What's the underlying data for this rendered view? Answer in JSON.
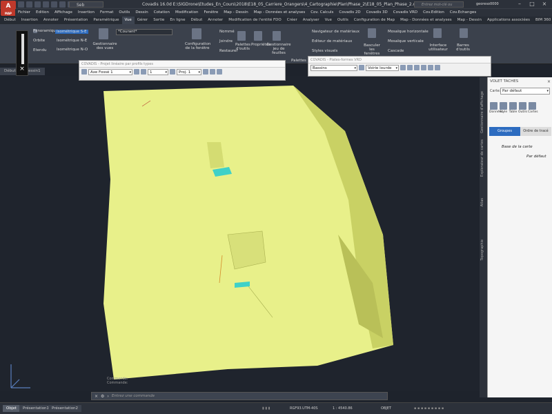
{
  "app": {
    "logo": "A",
    "logo_sub": "MAP",
    "workspace": "Seb",
    "title": "Covadis 16.0d    E:\\SIGDrone\\Etudes_En_Cours\\2018\\E18_05_Carriere_Orangers\\4_Cartographie\\Plan\\Phase_2\\E18_05_Plan_Phase_2.dwg (1:200)",
    "search_placeholder": "Entrez mot-clé ou expression",
    "user": "georeso0000"
  },
  "menu": [
    "Fichier",
    "Edition",
    "Affichage",
    "Insertion",
    "Format",
    "Outils",
    "Dessin",
    "Cotation",
    "Modification",
    "Fenêtre",
    "Map - Dessin",
    "Map - Données et analyses",
    "Cov. Calculs",
    "Covadis 2D",
    "Covadis 3D",
    "Covadis VRD",
    "Cov.Edition",
    "Cov.Echanges"
  ],
  "ribbon_tabs": [
    "Début",
    "Insertion",
    "Annoter",
    "Présentation",
    "Paramétrique",
    "Vue",
    "Gérer",
    "Sortie",
    "En ligne",
    "Début",
    "Annoter",
    "Modification de l'entité FDO",
    "Créer",
    "Analyser",
    "Vue",
    "Outils",
    "Configuration de Map",
    "Map - Données et analyses",
    "Map - Dessin",
    "Applications associées",
    "BIM 360",
    "Performance"
  ],
  "ribbon_active": 5,
  "ribbon": {
    "panoramique": "Panoramique",
    "orbite": "Orbite",
    "etendu": "Etendu",
    "iso1": "Isométrique S-E",
    "iso2": "Isométrique N-E",
    "iso3": "Isométrique N-O",
    "gestion_vues": "Gestionnaire des vues",
    "courant": "*Courant*",
    "config_fenetre": "Configuration de la fenêtre",
    "nomme": "Nommé",
    "joindre": "Joindre",
    "restaurer": "Restaurer",
    "palettes_outils": "Palettes d'outils",
    "proprietes": "Propriétés",
    "gestion_feuilles": "Gestionnaire jeu de feuilles",
    "palettes": "Palettes",
    "nav_materiaux": "Navigateur de matériaux",
    "editeur_materiaux": "Editeur de matériaux",
    "styles_visuels": "Styles visuels",
    "basculer": "Basculer les fenêtres",
    "mosaique_h": "Mosaïque horizontale",
    "mosaique_v": "Mosaïque verticale",
    "cascade": "Cascade",
    "interface": "Interface utilisateur",
    "barres_outils": "Barres d'outils"
  },
  "doc_tabs": [
    "Début",
    "Dessin1"
  ],
  "panel_profil": {
    "title": "COVADIS - Projet linéaire par profils types",
    "axe": "Axe Fossé 1",
    "num": "1",
    "proj": "Proj. 1"
  },
  "panel_plateformes": {
    "title": "COVADIS - Plates-formes VRD",
    "type": "Bassins",
    "voirie": "Voirie lourde"
  },
  "command": {
    "history1": "Commande:",
    "history2": "Commande:",
    "prompt": "Entrez une commande"
  },
  "layout_tabs": [
    "Objet",
    "Présentation1",
    "Présentation2"
  ],
  "status": {
    "coords": "RGF93.UTM-40S",
    "scale": "1 : 4540.86",
    "mode": "OBJET"
  },
  "taskpane": {
    "title": "VOLET TACHES",
    "carte_label": "Carte:",
    "carte_value": "Par défaut",
    "tools": [
      "Données",
      "Style",
      "Table",
      "Outils",
      "Cartes"
    ],
    "tabs": [
      "Groupes",
      "Ordre de tracé"
    ],
    "tree_root": "Base de la carte",
    "tree_child": "Par défaut"
  },
  "vertical_tabs": [
    "Gestionnaire d'affichage",
    "Explorateur de cartes",
    "Atlas",
    "Topographie"
  ],
  "colors": {
    "terrain": "#e8f08a",
    "terrain_shadow": "#c9d164",
    "basin": "#3fd1c8",
    "accent": "#2d6cc0",
    "background": "#1f242d"
  }
}
